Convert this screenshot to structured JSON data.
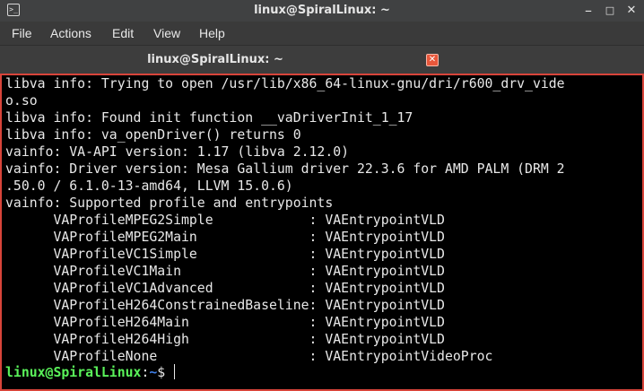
{
  "window": {
    "title": "linux@SpiralLinux: ~",
    "icon_glyph": ">_",
    "buttons": {
      "minimize": "–",
      "maximize": "□",
      "close": "✕"
    }
  },
  "menubar": {
    "items": [
      "File",
      "Actions",
      "Edit",
      "View",
      "Help"
    ]
  },
  "tab": {
    "label": "linux@SpiralLinux: ~",
    "close_glyph": "✕"
  },
  "terminal": {
    "lines": [
      "libva info: Trying to open /usr/lib/x86_64-linux-gnu/dri/r600_drv_vide",
      "o.so",
      "libva info: Found init function __vaDriverInit_1_17",
      "libva info: va_openDriver() returns 0",
      "vainfo: VA-API version: 1.17 (libva 2.12.0)",
      "vainfo: Driver version: Mesa Gallium driver 22.3.6 for AMD PALM (DRM 2",
      ".50.0 / 6.1.0-13-amd64, LLVM 15.0.6)",
      "vainfo: Supported profile and entrypoints",
      "      VAProfileMPEG2Simple            : VAEntrypointVLD",
      "      VAProfileMPEG2Main              : VAEntrypointVLD",
      "      VAProfileVC1Simple              : VAEntrypointVLD",
      "      VAProfileVC1Main                : VAEntrypointVLD",
      "      VAProfileVC1Advanced            : VAEntrypointVLD",
      "      VAProfileH264ConstrainedBaseline: VAEntrypointVLD",
      "      VAProfileH264Main               : VAEntrypointVLD",
      "      VAProfileH264High               : VAEntrypointVLD",
      "      VAProfileNone                   : VAEntrypointVideoProc"
    ],
    "prompt": {
      "user_host": "linux@SpiralLinux",
      "separator": ":",
      "path": "~",
      "symbol": "$ "
    },
    "colors": {
      "background": "#000000",
      "text": "#e8e8e8",
      "prompt_user": "#5af35a",
      "prompt_path": "#3f7fe8",
      "focus_border": "#d8443a"
    }
  }
}
